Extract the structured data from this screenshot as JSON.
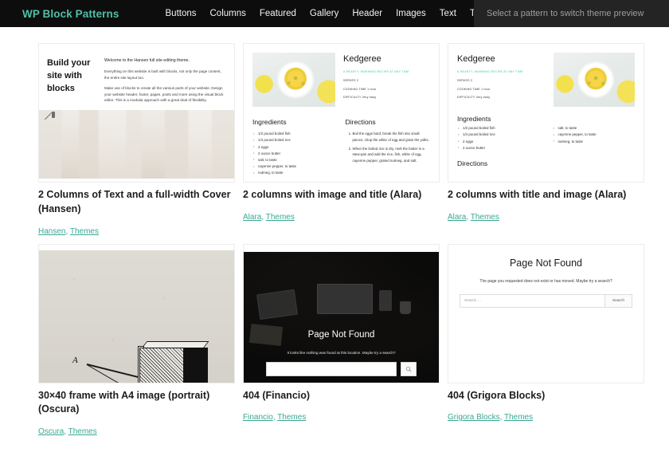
{
  "header": {
    "brand": "WP Block Patterns",
    "nav": [
      {
        "label": "Buttons"
      },
      {
        "label": "Columns"
      },
      {
        "label": "Featured"
      },
      {
        "label": "Gallery"
      },
      {
        "label": "Header"
      },
      {
        "label": "Images"
      },
      {
        "label": "Text"
      },
      {
        "label": "Themes"
      }
    ],
    "preview_note": "Select a pattern to switch theme preview",
    "brand_color": "#4fbfa8",
    "bar_color": "#0d0d0d",
    "note_bg": "#242424"
  },
  "link_color": "#3aa893",
  "cards": [
    {
      "title": "2 Columns of Text and a full-width Cover (Hansen)",
      "taxonomy": [
        "Hansen",
        "Themes"
      ],
      "preview": {
        "heading": "Build your site with blocks",
        "lead": "Welcome to the Hansen full site editing theme.",
        "paragraphs": [
          "Everything on this website is built with blocks, not only the page content, the entire site layout too.",
          "Make use of blocks to create all the various parts of your website. Design your website header, footer, pages, posts and more using the visual block editor. This is a modular approach with a great deal of flexibility."
        ]
      }
    },
    {
      "title": "2 columns with image and title (Alara)",
      "taxonomy": [
        "Alara",
        "Themes"
      ],
      "preview": {
        "recipe_title": "Kedgeree",
        "tagline": "A HEARTY, WARMING RECIPE AT ANY TIME",
        "serves": "SERVES 2",
        "cooking_time": "COOKING TIME 1 hour",
        "difficulty": "DIFFICULTY Very easy",
        "ingredients_heading": "Ingredients",
        "ingredients": [
          "1/2 pound boiled fish",
          "1/4 pound boiled rice",
          "2 eggs",
          "2 ounce butter",
          "salt, to taste",
          "cayenne pepper, to taste",
          "nutmeg, to taste"
        ],
        "directions_heading": "Directions",
        "directions": [
          "Boil the eggs hard, break the fish into small pieces, chop the white of egg and grate the yolks.",
          "When the boiled rice is dry, melt the butter in a stew-pan and add the rice, fish, white of egg, cayenne pepper, grated nutmeg, and salt."
        ]
      }
    },
    {
      "title": "2 columns with title and image (Alara)",
      "taxonomy": [
        "Alara",
        "Themes"
      ],
      "preview": {
        "recipe_title": "Kedgeree",
        "tagline": "A HEARTY, WARMING RECIPE AT ANY TIME",
        "serves": "SERVES 2",
        "cooking_time": "COOKING TIME 1 hour",
        "difficulty": "DIFFICULTY Very easy",
        "ingredients_heading": "Ingredients",
        "ingredients_left": [
          "1/2 pound boiled fish",
          "1/4 pound boiled rice",
          "2 eggs",
          "2 ounce butter"
        ],
        "ingredients_right": [
          "salt, to taste",
          "cayenne pepper, to taste",
          "nutmeg, to taste"
        ],
        "directions_heading": "Directions"
      }
    },
    {
      "title": "30×40 frame with A4 image (portrait) (Oscura)",
      "taxonomy": [
        "Oscura",
        "Themes"
      ],
      "preview": {
        "figure_label": "A"
      }
    },
    {
      "title": "404 (Financio)",
      "taxonomy": [
        "Financio",
        "Themes"
      ],
      "preview": {
        "heading": "Page Not Found",
        "subtext": "It looks like nothing was found at this location. Maybe try a search?",
        "search_value": "",
        "search_icon": "search-icon"
      }
    },
    {
      "title": "404 (Grigora Blocks)",
      "taxonomy": [
        "Grigora Blocks",
        "Themes"
      ],
      "preview": {
        "heading": "Page Not Found",
        "subtext": "The page you requested does not exist or has moved. Maybe try a search?",
        "search_placeholder": "Search …",
        "search_button": "Search"
      }
    }
  ]
}
